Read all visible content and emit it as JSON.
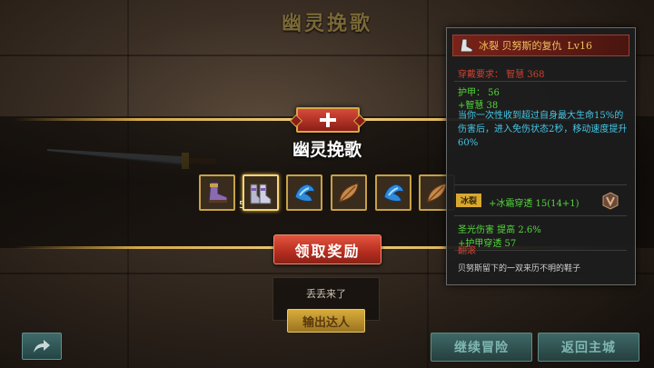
{
  "header": {
    "title": "幽灵挽歌"
  },
  "reward": {
    "title": "幽灵挽歌",
    "items": [
      {
        "icon": "boots-purple-icon",
        "count": "5"
      },
      {
        "icon": "boots-silver-icon",
        "count": ""
      },
      {
        "icon": "ice-gem-icon",
        "count": ""
      },
      {
        "icon": "feather-leaf-icon",
        "count": ""
      },
      {
        "icon": "ice-gem-icon",
        "count": ""
      },
      {
        "icon": "feather-leaf-icon",
        "count": ""
      }
    ],
    "claim_label": "领取奖励"
  },
  "message": {
    "text": "丢丢来了",
    "badge": "输出达人"
  },
  "footer": {
    "continue_label": "继续冒险",
    "return_label": "返回主城"
  },
  "tooltip": {
    "name": "冰裂 贝努斯的复仇",
    "level": "Lv16",
    "requirement": "穿戴要求： 智慧 368",
    "stats": [
      "护甲： 56",
      "+智慧 38"
    ],
    "effect": "当你一次性收到超过自身最大生命15%的伤害后，进入免伤状态2秒，移动速度提升60%",
    "gem": {
      "tag": "冰裂",
      "stat": "+冰霜穿透 15(14+1)"
    },
    "bonus": [
      "圣光伤害 提高 2.6%",
      "+护甲穿透 57"
    ],
    "section": "翻滚",
    "flavor": "贝努斯留下的一双来历不明的鞋子"
  },
  "colors": {
    "gold": "#d4a84a",
    "red_button": "#b42d1f",
    "teal_button": "#2f5452",
    "stat_green": "#52d83a",
    "effect_blue": "#44c8e6",
    "requirement_red": "#d04030"
  }
}
